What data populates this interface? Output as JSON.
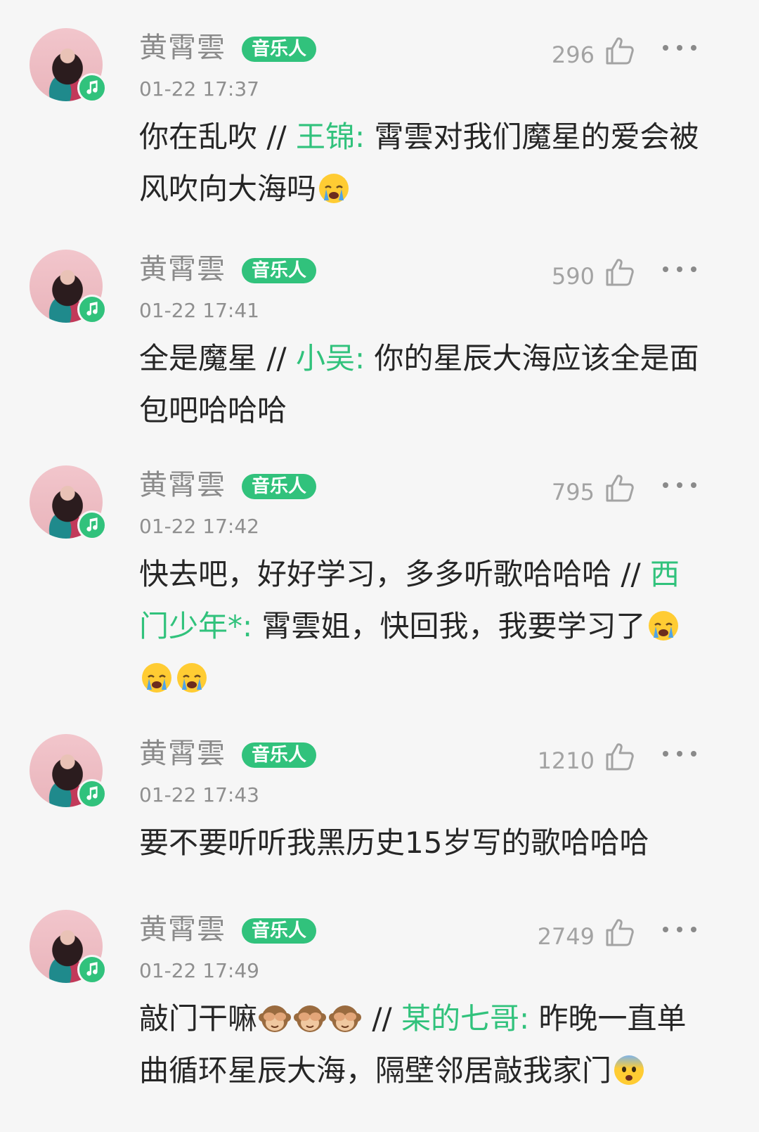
{
  "comments": [
    {
      "user": "黄霄雲",
      "badge": "音乐人",
      "time": "01-22 17:37",
      "likes": "296",
      "reply_text": "你在乱吹 // ",
      "mention": "王锦:",
      "quoted_text": " 霄雲对我们魔星的爱会被风吹向大海吗",
      "emojis": [
        "crying-face"
      ]
    },
    {
      "user": "黄霄雲",
      "badge": "音乐人",
      "time": "01-22 17:41",
      "likes": "590",
      "reply_text": "全是魔星 // ",
      "mention": "小吴:",
      "quoted_text": " 你的星辰大海应该全是面包吧哈哈哈",
      "emojis": []
    },
    {
      "user": "黄霄雲",
      "badge": "音乐人",
      "time": "01-22 17:42",
      "likes": "795",
      "reply_text": "快去吧，好好学习，多多听歌哈哈哈 // ",
      "mention": "西门少年*:",
      "quoted_text": " 霄雲姐，快回我，我要学习了",
      "emojis": [
        "crying-face",
        "crying-face",
        "crying-face"
      ]
    },
    {
      "user": "黄霄雲",
      "badge": "音乐人",
      "time": "01-22 17:43",
      "likes": "1210",
      "reply_text": "要不要听听我黑历史15岁写的歌哈哈哈",
      "mention": "",
      "quoted_text": "",
      "emojis": []
    },
    {
      "user": "黄霄雲",
      "badge": "音乐人",
      "time": "01-22 17:49",
      "likes": "2749",
      "reply_text": "敲门干嘛",
      "reply_emojis": [
        "see-no-evil-monkey",
        "see-no-evil-monkey",
        "see-no-evil-monkey"
      ],
      "reply_suffix": " // ",
      "mention": "某的七哥:",
      "quoted_text": " 昨晚一直单曲循环星辰大海，隔壁邻居敲我家门",
      "emojis": [
        "anxious-face"
      ]
    }
  ],
  "colors": {
    "accent": "#31c27c",
    "text": "#262626",
    "meta": "#8f8f8f",
    "background": "#f6f6f6"
  }
}
